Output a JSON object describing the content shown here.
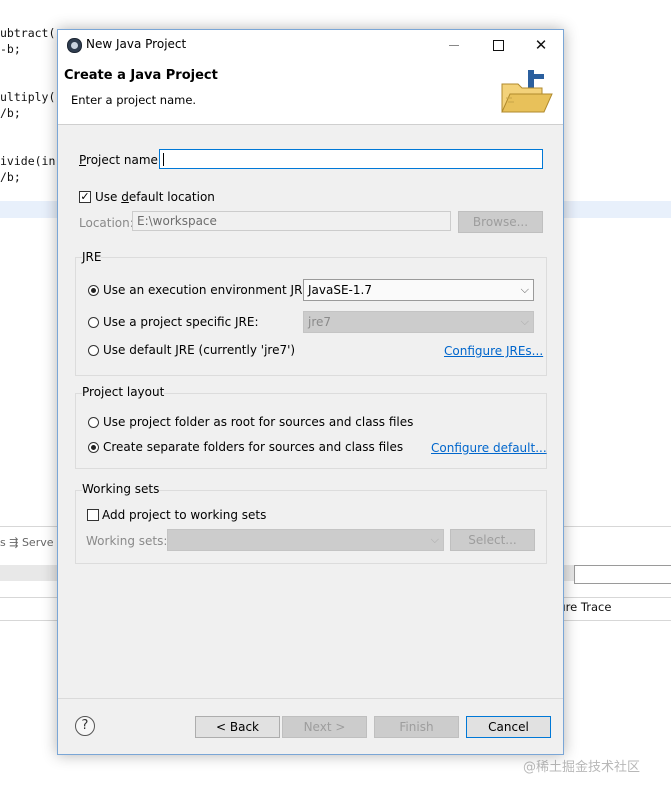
{
  "background": {
    "code_lines": [
      "ubtract(",
      "-b;",
      "",
      "",
      "ultiply(",
      "/b;",
      "",
      "",
      "ivide(in",
      "/b;"
    ],
    "tabs_text": "s  ⇶ Serve",
    "failure_trace": "ilure Trace",
    "watermark": "@稀土掘金技术社区"
  },
  "dialog": {
    "title": "New Java Project",
    "banner_title": "Create a Java Project",
    "banner_message": "Enter a project name.",
    "project_name_label": "Project name:",
    "project_name_value": "",
    "use_default_location_label": "Use default location",
    "use_default_location_checked": true,
    "location_label": "Location:",
    "location_value": "E:\\workspace",
    "browse_label": "Browse...",
    "jre": {
      "group_label": "JRE",
      "option_env_label": "Use an execution environment JRE:",
      "env_value": "JavaSE-1.7",
      "option_specific_label": "Use a project specific JRE:",
      "specific_value": "jre7",
      "option_default_label": "Use default JRE (currently 'jre7')",
      "configure_link": "Configure JREs...",
      "selected": "env"
    },
    "layout": {
      "group_label": "Project layout",
      "option_root_label": "Use project folder as root for sources and class files",
      "option_separate_label": "Create separate folders for sources and class files",
      "configure_link": "Configure default...",
      "selected": "separate"
    },
    "working_sets": {
      "group_label": "Working sets",
      "add_label": "Add project to working sets",
      "add_checked": false,
      "sets_label": "Working sets:",
      "select_label": "Select..."
    },
    "buttons": {
      "back": "< Back",
      "next": "Next >",
      "finish": "Finish",
      "cancel": "Cancel",
      "help": "?"
    }
  }
}
